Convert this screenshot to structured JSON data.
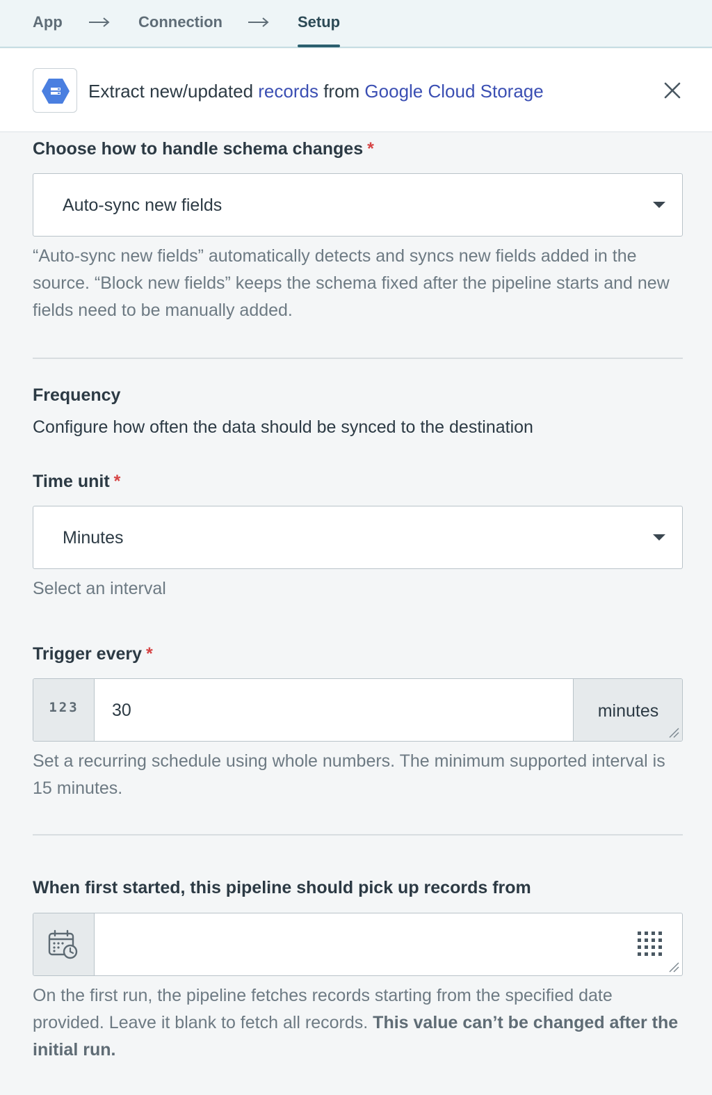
{
  "stepper": {
    "steps": [
      {
        "label": "App"
      },
      {
        "label": "Connection"
      },
      {
        "label": "Setup"
      }
    ]
  },
  "header": {
    "title_prefix": "Extract new/updated ",
    "title_link1": "records",
    "title_middle": " from ",
    "title_link2": "Google Cloud Storage",
    "logo_icon": "google-cloud-storage-icon",
    "close_icon": "close-icon"
  },
  "schema": {
    "label": "Choose how to handle schema changes",
    "required_mark": "*",
    "selected": "Auto-sync new fields",
    "help": "“Auto-sync new fields” automatically detects and syncs new fields added in the source. “Block new fields” keeps the schema fixed after the pipeline starts and new fields need to be manually added."
  },
  "frequency": {
    "title": "Frequency",
    "description": "Configure how often the data should be synced to the destination",
    "time_unit": {
      "label": "Time unit",
      "required_mark": "*",
      "selected": "Minutes",
      "help": "Select an interval"
    },
    "trigger": {
      "label": "Trigger every",
      "required_mark": "*",
      "addon_left": "123",
      "value": "30",
      "unit": "minutes",
      "help": "Set a recurring schedule using whole numbers. The minimum supported interval is 15 minutes."
    }
  },
  "start": {
    "label": "When first started, this pipeline should pick up records from",
    "value": "",
    "calendar_icon": "calendar-clock-icon",
    "grid_icon": "keypad-grid-icon",
    "help_normal": "On the first run, the pipeline fetches records starting from the specified date provided. Leave it blank to fetch all records. ",
    "help_bold": "This value can’t be changed after the initial run."
  },
  "colors": {
    "accent": "#2b5f6e",
    "link": "#3b4fb3",
    "required": "#d64545",
    "logo_blue": "#4a7fe0"
  }
}
